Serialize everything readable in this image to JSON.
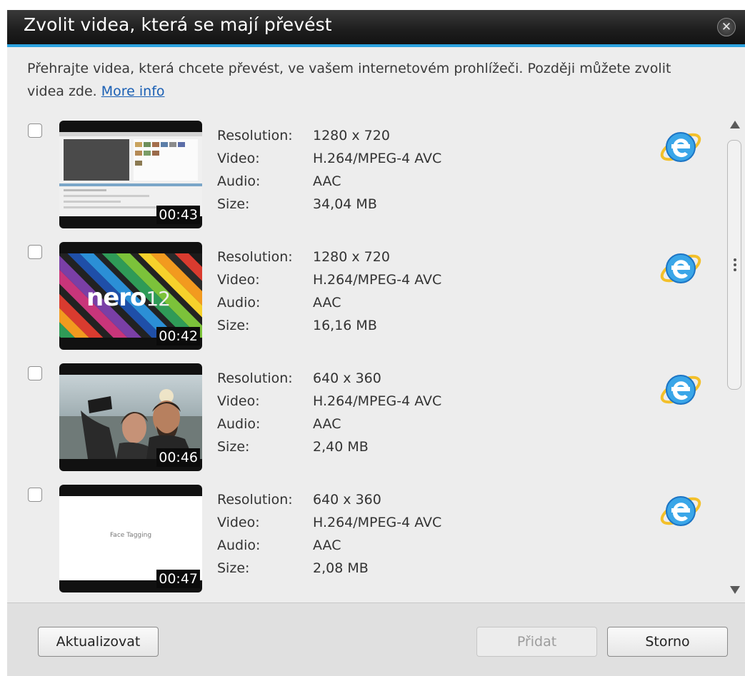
{
  "dialog": {
    "title": "Zvolit videa, která se mají převést",
    "close_glyph": "✕",
    "intro_text": "Přehrajte videa, která chcete převést, ve vašem internetovém prohlížeči. Později můžete zvolit videa zde.",
    "more_info_link": "More info"
  },
  "labels": {
    "resolution": "Resolution:",
    "video": "Video:",
    "audio": "Audio:",
    "size": "Size:"
  },
  "videos": [
    {
      "duration": "00:43",
      "resolution": "1280 x 720",
      "video": "H.264/MPEG-4 AVC",
      "audio": "AAC",
      "size": "34,04 MB",
      "checked": false,
      "browser_icon": "internet-explorer-icon"
    },
    {
      "duration": "00:42",
      "resolution": "1280 x 720",
      "video": "H.264/MPEG-4 AVC",
      "audio": "AAC",
      "size": "16,16 MB",
      "checked": false,
      "browser_icon": "internet-explorer-icon",
      "thumb_text": "nero",
      "thumb_text_suffix": "12"
    },
    {
      "duration": "00:46",
      "resolution": "640 x 360",
      "video": "H.264/MPEG-4 AVC",
      "audio": "AAC",
      "size": "2,40 MB",
      "checked": false,
      "browser_icon": "internet-explorer-icon"
    },
    {
      "duration": "00:47",
      "resolution": "640 x 360",
      "video": "H.264/MPEG-4 AVC",
      "audio": "AAC",
      "size": "2,08 MB",
      "checked": false,
      "browser_icon": "internet-explorer-icon",
      "thumb_text": "Face Tagging"
    }
  ],
  "footer": {
    "refresh_label": "Aktualizovat",
    "add_label": "Přidat",
    "cancel_label": "Storno"
  },
  "colors": {
    "accent": "#2ca3e0",
    "link": "#1a5fb4",
    "titlebar": "#1d1d1d"
  }
}
